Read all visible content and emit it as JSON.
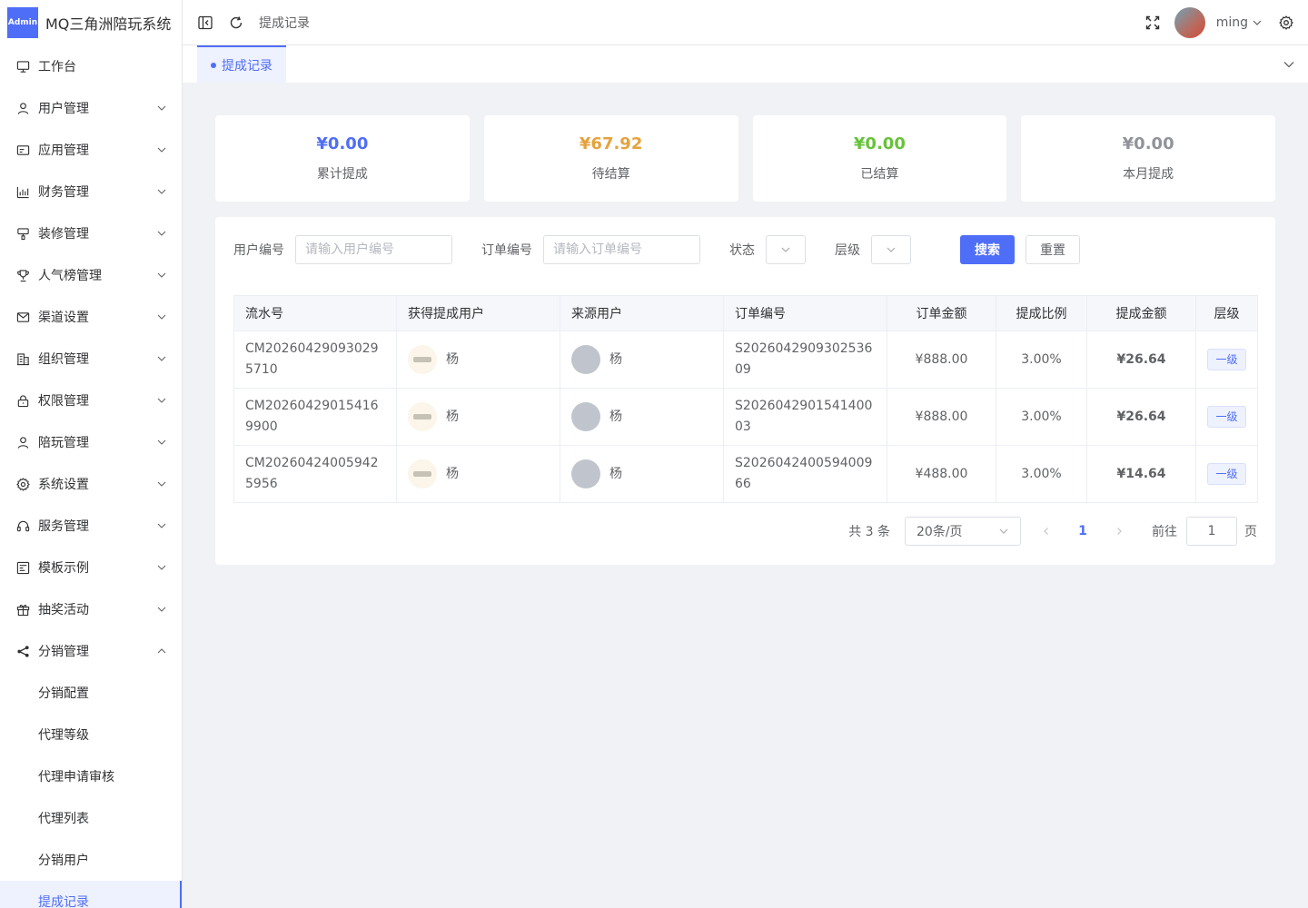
{
  "app": {
    "badge": "Admin",
    "title": "MQ三角洲陪玩系统"
  },
  "sidebar": {
    "items": [
      {
        "label": "工作台",
        "icon": "monitor-icon",
        "arrow": false
      },
      {
        "label": "用户管理",
        "icon": "user-icon",
        "arrow": "down"
      },
      {
        "label": "应用管理",
        "icon": "app-card-icon",
        "arrow": "down"
      },
      {
        "label": "财务管理",
        "icon": "bar-chart-icon",
        "arrow": "down"
      },
      {
        "label": "装修管理",
        "icon": "paint-icon",
        "arrow": "down"
      },
      {
        "label": "人气榜管理",
        "icon": "trophy-icon",
        "arrow": "down"
      },
      {
        "label": "渠道设置",
        "icon": "mail-icon",
        "arrow": "down"
      },
      {
        "label": "组织管理",
        "icon": "building-icon",
        "arrow": "down"
      },
      {
        "label": "权限管理",
        "icon": "lock-icon",
        "arrow": "down"
      },
      {
        "label": "陪玩管理",
        "icon": "user-icon",
        "arrow": "down"
      },
      {
        "label": "系统设置",
        "icon": "gear-icon",
        "arrow": "down"
      },
      {
        "label": "服务管理",
        "icon": "headset-icon",
        "arrow": "down"
      },
      {
        "label": "模板示例",
        "icon": "template-icon",
        "arrow": "down"
      },
      {
        "label": "抽奖活动",
        "icon": "gift-icon",
        "arrow": "down"
      },
      {
        "label": "分销管理",
        "icon": "share-icon",
        "arrow": "up"
      }
    ],
    "sub_items": [
      {
        "label": "分销配置",
        "active": false
      },
      {
        "label": "代理等级",
        "active": false
      },
      {
        "label": "代理申请审核",
        "active": false
      },
      {
        "label": "代理列表",
        "active": false
      },
      {
        "label": "分销用户",
        "active": false
      },
      {
        "label": "提成记录",
        "active": true
      }
    ]
  },
  "header": {
    "breadcrumb": "提成记录",
    "username": "ming"
  },
  "tags": {
    "active": "提成记录"
  },
  "stats": [
    {
      "value": "¥0.00",
      "label": "累计提成",
      "color": "#4f6ef7"
    },
    {
      "value": "¥67.92",
      "label": "待结算",
      "color": "#e6a23c"
    },
    {
      "value": "¥0.00",
      "label": "已结算",
      "color": "#67c23a"
    },
    {
      "value": "¥0.00",
      "label": "本月提成",
      "color": "#909399"
    }
  ],
  "filters": {
    "user_no_label": "用户编号",
    "user_no_placeholder": "请输入用户编号",
    "order_no_label": "订单编号",
    "order_no_placeholder": "请输入订单编号",
    "status_label": "状态",
    "level_label": "层级",
    "search_btn": "搜索",
    "reset_btn": "重置"
  },
  "table": {
    "columns": [
      "流水号",
      "获得提成用户",
      "来源用户",
      "订单编号",
      "订单金额",
      "提成比例",
      "提成金额",
      "层级"
    ],
    "rows": [
      {
        "serial": "CM202604290930295710",
        "earner": "杨",
        "source": "杨",
        "order": "S202604290930253609",
        "order_amount": "¥888.00",
        "rate": "3.00%",
        "commission": "¥26.64",
        "level": "一级"
      },
      {
        "serial": "CM202604290154169900",
        "earner": "杨",
        "source": "杨",
        "order": "S202604290154140003",
        "order_amount": "¥888.00",
        "rate": "3.00%",
        "commission": "¥26.64",
        "level": "一级"
      },
      {
        "serial": "CM202604240059425956",
        "earner": "杨",
        "source": "杨",
        "order": "S202604240059400966",
        "order_amount": "¥488.00",
        "rate": "3.00%",
        "commission": "¥14.64",
        "level": "一级"
      }
    ]
  },
  "pagination": {
    "total": "共 3 条",
    "page_size": "20条/页",
    "current": "1",
    "goto_label": "前往",
    "goto_value": "1",
    "page_suffix": "页"
  }
}
